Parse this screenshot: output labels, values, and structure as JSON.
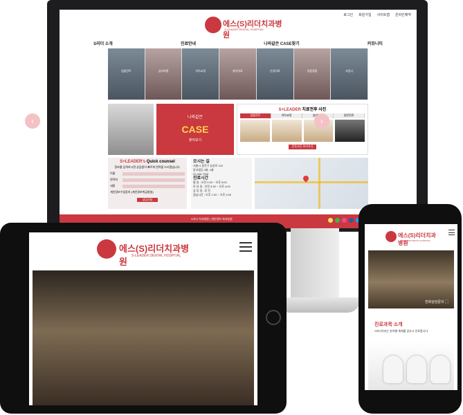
{
  "desktop": {
    "top_links": [
      "로그인",
      "회원가입",
      "사이트맵",
      "온라인예약"
    ],
    "brand_kr": "에스(S)리더치과병원",
    "brand_en": "S-LEADER DENTAL HOSPITAL",
    "menu": [
      "S리더 소개",
      "진료안내",
      "나와같은 CASE찾기",
      "커뮤니티"
    ],
    "tiles": [
      "임플란트",
      "심미보철",
      "치아교정",
      "충치치료",
      "신경치료",
      "잇몸질환",
      "사랑니"
    ],
    "case_card": {
      "line1": "나와같은",
      "line2": "CASE",
      "line3": "찾아보기"
    },
    "before_after": {
      "title_brand": "S+LEADER",
      "title_rest": " 치료전후 사진",
      "tabs": [
        "임플란트",
        "치아교정",
        "심미보철",
        "일반진료"
      ],
      "button": "전후사진 보러가기"
    },
    "quick": {
      "title_brand": "S+LEADER's",
      "title_rest": " Quick counsel",
      "desc": "정보를 입력하시면 상담원이 빠르게 연락을 드리겠습니다.",
      "fields": [
        "이름",
        "연락처",
        "내용"
      ],
      "agree": "개인정보수집동의 (개인정보취급방침)",
      "submit": "상담신청"
    },
    "info": {
      "loc_title": "오시는 길",
      "address": "서울시 광진구 능동로 102",
      "address2": "동서빌딩 3층, 4층",
      "phone": "02.466.7526",
      "hours_title": "진료시간",
      "hours": [
        "평 일 : 오전 9:30 ~ 오후 8:00",
        "토 요 일 : 오전 9:30 ~ 오후 4:00",
        "공 휴 일 : 휴 진",
        "점심시간 : 오후 1:00 ~ 오후 2:00"
      ]
    },
    "footer_text": "S리더 치과병원 | 개인정보 처리방침"
  },
  "tablet": {
    "brand_kr": "에스(S)리더치과병원",
    "brand_en": "S-LEADER DENTAL HOSPITAL"
  },
  "phone": {
    "brand_kr": "에스(S)리더치과병원",
    "brand_en": "S-LEADER DENTAL HOSPITAL",
    "photo_caption": "전화상담문의 ▢",
    "section_title": "진료과목 소개",
    "section_desc": "S리더치과는 분야별 체계를 갖추고 진료합니다."
  }
}
